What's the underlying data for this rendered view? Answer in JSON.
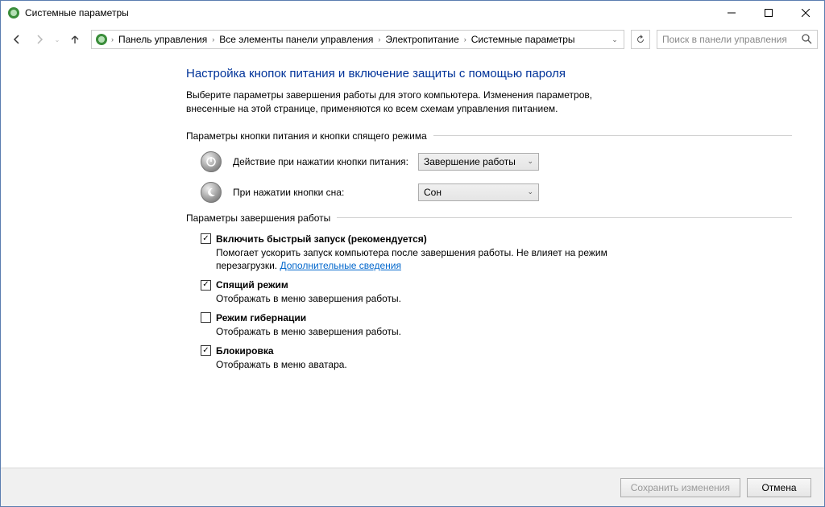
{
  "window": {
    "title": "Системные параметры"
  },
  "breadcrumb": {
    "items": [
      "Панель управления",
      "Все элементы панели управления",
      "Электропитание",
      "Системные параметры"
    ]
  },
  "search": {
    "placeholder": "Поиск в панели управления"
  },
  "page": {
    "heading": "Настройка кнопок питания и включение защиты с помощью пароля",
    "subtext": "Выберите параметры завершения работы для этого компьютера. Изменения параметров, внесенные на этой странице, применяются ко всем схемам управления питанием."
  },
  "section1": {
    "title": "Параметры кнопки питания и кнопки спящего режима",
    "power_label": "Действие при нажатии кнопки питания:",
    "power_value": "Завершение работы",
    "sleep_label": "При нажатии кнопки сна:",
    "sleep_value": "Сон"
  },
  "section2": {
    "title": "Параметры завершения работы",
    "items": [
      {
        "checked": true,
        "label": "Включить быстрый запуск (рекомендуется)",
        "desc_before": "Помогает ускорить запуск компьютера после завершения работы. Не влияет на режим перезагрузки. ",
        "link": "Дополнительные сведения"
      },
      {
        "checked": true,
        "label": "Спящий режим",
        "desc": "Отображать в меню завершения работы."
      },
      {
        "checked": false,
        "label": "Режим гибернации",
        "desc": "Отображать в меню завершения работы."
      },
      {
        "checked": true,
        "label": "Блокировка",
        "desc": "Отображать в меню аватара."
      }
    ]
  },
  "footer": {
    "save": "Сохранить изменения",
    "cancel": "Отмена"
  }
}
